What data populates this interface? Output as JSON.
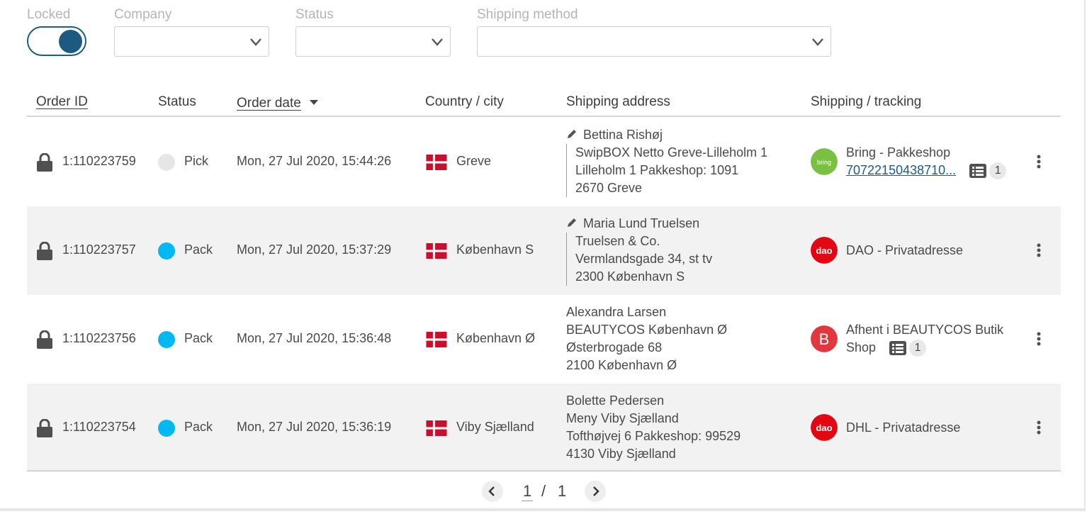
{
  "filters": {
    "locked_label": "Locked",
    "company_label": "Company",
    "status_label": "Status",
    "shipping_method_label": "Shipping method",
    "company_value": "",
    "status_value": "",
    "shipping_method_value": ""
  },
  "table": {
    "headers": {
      "order_id": "Order ID",
      "status": "Status",
      "order_date": "Order date",
      "country_city": "Country / city",
      "shipping_address": "Shipping address",
      "shipping_tracking": "Shipping / tracking"
    },
    "rows": [
      {
        "order_id": "1:110223759",
        "status": "Pick",
        "status_color": "#e6e6e6",
        "order_date": "Mon, 27 Jul 2020, 15:44:26",
        "country_flag": "denmark-flag-icon",
        "city": "Greve",
        "address_name": "Bettina Rishøj",
        "address_line1": "SwipBOX Netto Greve-Lilleholm 1",
        "address_line2": "Lilleholm 1 Pakkeshop: 1091",
        "address_line3": "2670 Greve",
        "carrier": "Bring - Pakkeshop",
        "carrier_logo_text": "bring",
        "carrier_logo_color": "#7ac143",
        "tracking": "70722150438710...",
        "tracking_count": "1"
      },
      {
        "order_id": "1:110223757",
        "status": "Pack",
        "status_color": "#00b9f2",
        "order_date": "Mon, 27 Jul 2020, 15:37:29",
        "country_flag": "denmark-flag-icon",
        "city": "København S",
        "address_name": "Maria Lund Truelsen",
        "address_line1": "Truelsen & Co.",
        "address_line2": "Vermlandsgade 34, st tv",
        "address_line3": "2300 København S",
        "carrier": "DAO - Privatadresse",
        "carrier_logo_text": "dao",
        "carrier_logo_color": "#e30613"
      },
      {
        "order_id": "1:110223756",
        "status": "Pack",
        "status_color": "#00b9f2",
        "order_date": "Mon, 27 Jul 2020, 15:36:48",
        "country_flag": "denmark-flag-icon",
        "city": "København Ø",
        "address_name": "Alexandra Larsen",
        "address_line1": "BEAUTYCOS København Ø",
        "address_line2": "Østerbrogade 68",
        "address_line3": "2100 København Ø",
        "carrier_line1": "Afhent i BEAUTYCOS Butik",
        "carrier_line2": "Shop",
        "carrier_logo_text": "B",
        "carrier_logo_color": "#e0383e",
        "tracking_count": "1"
      },
      {
        "order_id": "1:110223754",
        "status": "Pack",
        "status_color": "#00b9f2",
        "order_date": "Mon, 27 Jul 2020, 15:36:19",
        "country_flag": "denmark-flag-icon",
        "city": "Viby Sjælland",
        "address_name": "Bolette Pedersen",
        "address_line1": "Meny Viby Sjælland",
        "address_line2": "Tofthøjvej 6 Pakkeshop: 99529",
        "address_line3": "4130 Viby Sjælland",
        "carrier": "DHL - Privatadresse",
        "carrier_logo_text": "dao",
        "carrier_logo_color": "#e30613"
      }
    ]
  },
  "pagination": {
    "current": "1",
    "separator": "/",
    "total": "1"
  },
  "colors": {
    "accent": "#1c5a82",
    "pick": "#e6e6e6",
    "pack": "#00b9f2",
    "danish_red": "#c8102e"
  }
}
